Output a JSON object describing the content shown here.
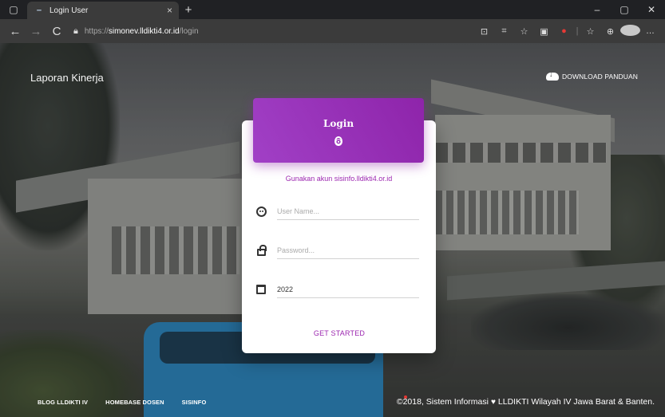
{
  "browser": {
    "tab_title": "Login User",
    "tab_close": "×",
    "new_tab": "+",
    "window_controls": {
      "minimize": "–",
      "restore": "▢",
      "close": "✕"
    },
    "nav": {
      "back": "←",
      "forward": "→",
      "reload": "C"
    },
    "url": {
      "protocol": "https://",
      "host": "simonev.lldikti4.or.id",
      "path": "/login"
    },
    "tools": [
      "⊡",
      "⌗",
      "☆",
      "▣",
      "●",
      "☆",
      "⊕",
      "…"
    ]
  },
  "page": {
    "brand": "Laporan Kinerja",
    "download_label": "DOWNLOAD PANDUAN",
    "card": {
      "title": "Login",
      "hint": "Gunakan akun sisinfo.lldikti4.or.id",
      "username_placeholder": "User Name...",
      "password_placeholder": "Password...",
      "year_value": "2022",
      "submit_label": "GET STARTED"
    },
    "footer": {
      "links": [
        "BLOG LLDIKTI IV",
        "HOMEBASE DOSEN",
        "SISINFO"
      ],
      "copyright_prefix": "©2018, Sistem Informasi",
      "copyright_suffix": "LLDIKTI Wilayah IV Jawa Barat & Banten."
    }
  },
  "colors": {
    "accent": "#9c27b0",
    "header_gradient_start": "#a140c6",
    "header_gradient_end": "#8e24aa"
  }
}
